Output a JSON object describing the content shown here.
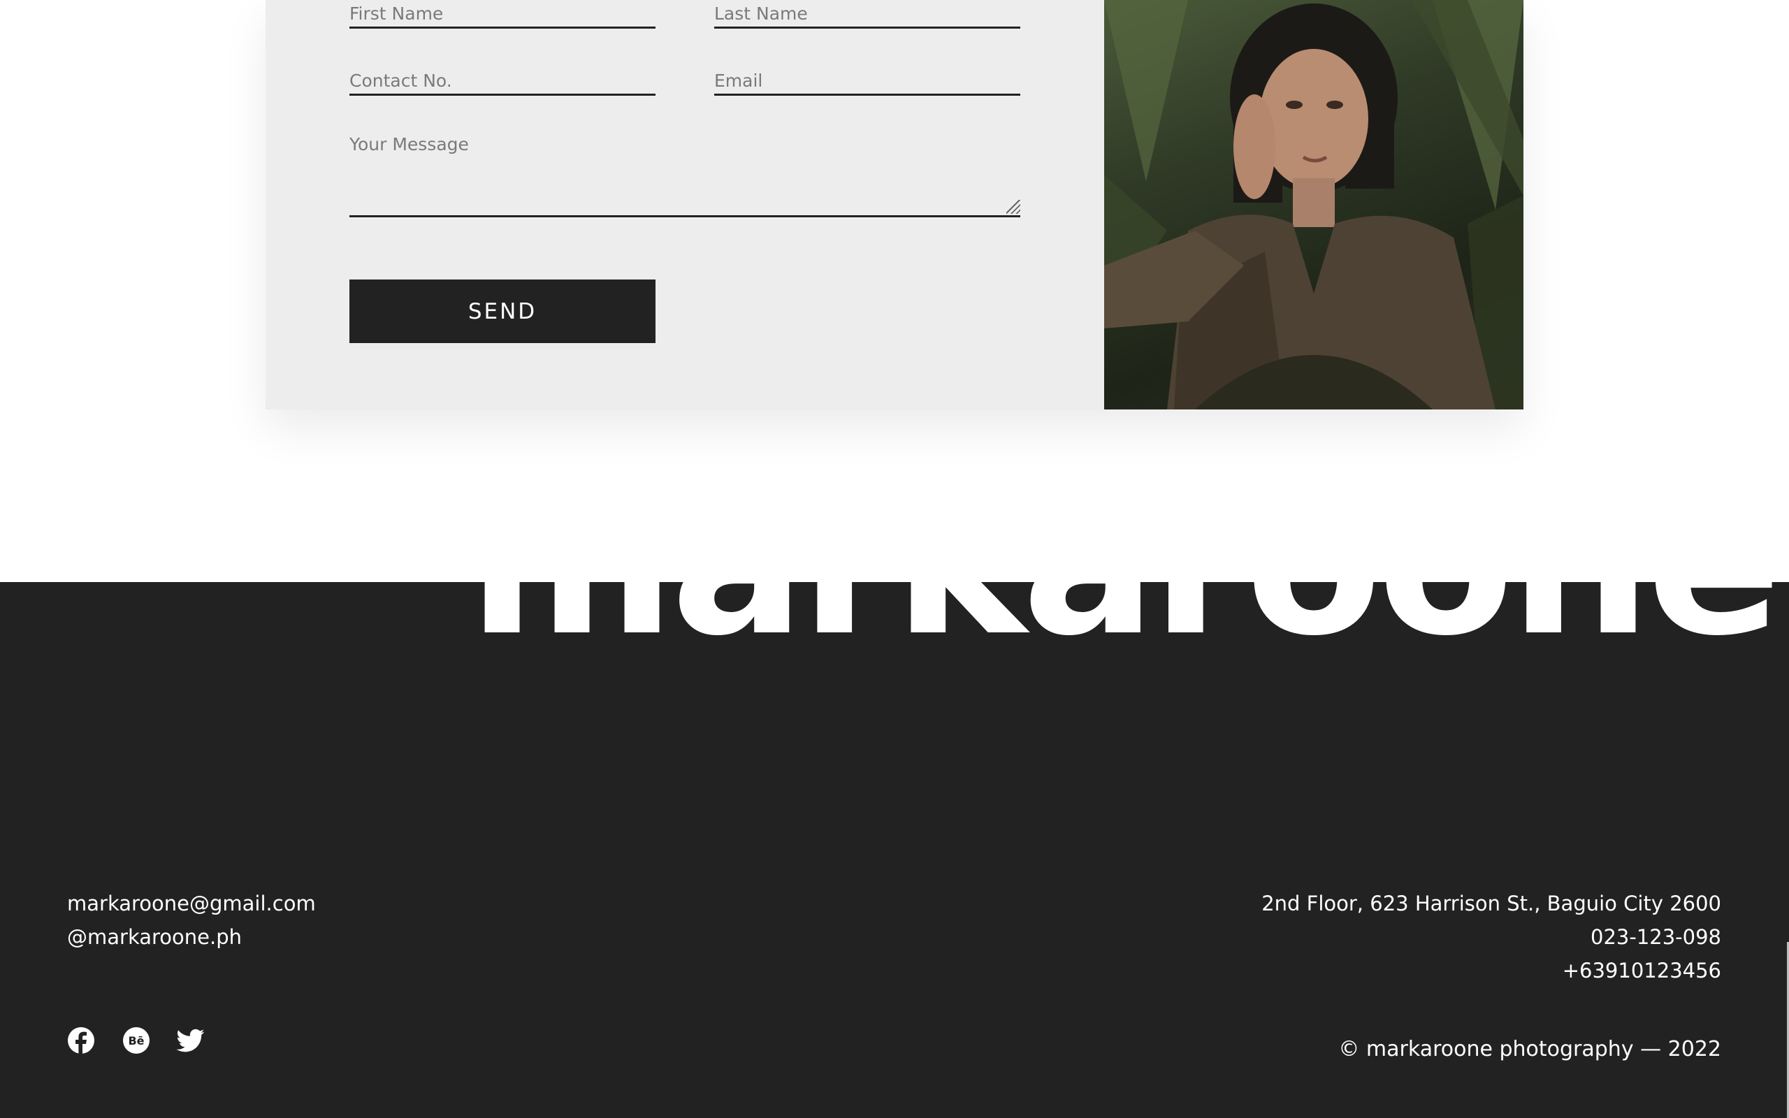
{
  "form": {
    "first_name_placeholder": "First Name",
    "last_name_placeholder": "Last Name",
    "contact_placeholder": "Contact No.",
    "email_placeholder": "Email",
    "message_placeholder": "Your Message",
    "send_label": "SEND"
  },
  "brand": {
    "wordmark": "markaroone."
  },
  "footer": {
    "email": "markaroone@gmail.com",
    "handle": "@markaroone.ph",
    "address": "2nd Floor, 623 Harrison St., Baguio City 2600",
    "phone_1": "023-123-098",
    "phone_2": "+63910123456",
    "copyright": "© markaroone photography — 2022",
    "social": [
      {
        "icon": "facebook-icon"
      },
      {
        "icon": "behance-icon"
      },
      {
        "icon": "twitter-icon"
      }
    ]
  },
  "colors": {
    "footer_bg": "#222222",
    "card_bg": "#ededed",
    "button_bg": "#222222"
  }
}
